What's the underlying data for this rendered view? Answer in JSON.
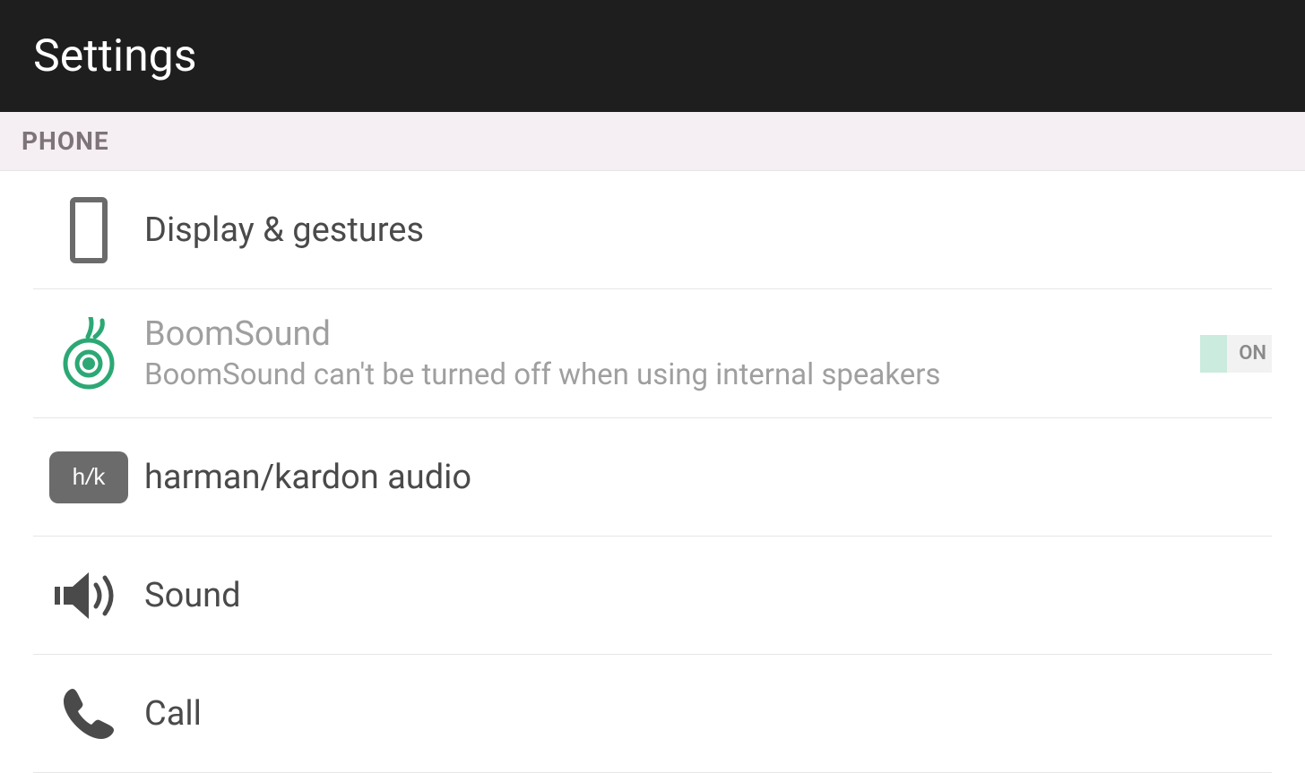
{
  "header": {
    "title": "Settings"
  },
  "section": {
    "label": "PHONE"
  },
  "items": {
    "display": {
      "title": "Display & gestures"
    },
    "boomsound": {
      "title": "BoomSound",
      "subtitle": "BoomSound can't be turned off when using internal speakers",
      "toggle_label": "ON"
    },
    "hk": {
      "title": "harman/kardon audio",
      "badge_left": "h",
      "badge_slash": "/",
      "badge_right": "k"
    },
    "sound": {
      "title": "Sound"
    },
    "call": {
      "title": "Call"
    }
  }
}
